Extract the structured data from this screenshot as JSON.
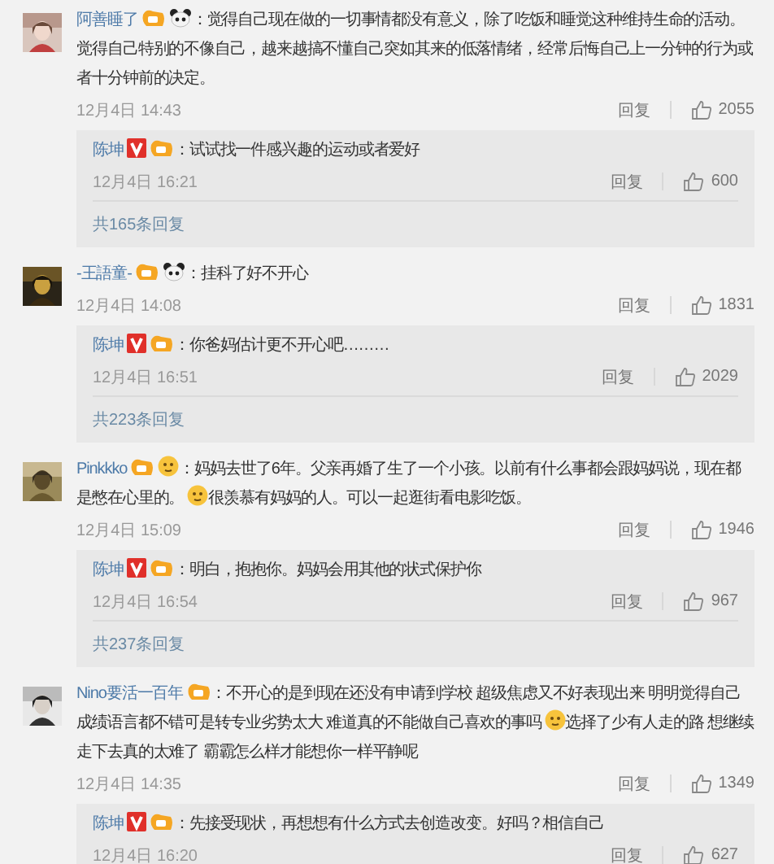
{
  "comments": [
    {
      "user": "阿善睡了",
      "badges": [
        {
          "kind": "level"
        },
        {
          "kind": "panda"
        }
      ],
      "segments": [
        {
          "kind": "text",
          "text": "：觉得自己现在做的一切事情都没有意义，除了吃饭和睡觉这种维持生命的活动。觉得自己特别的不像自己，越来越搞不懂自己突如其来的低落情绪，经常后悔自己上一分钟的行为或者十分钟前的决定。"
        }
      ],
      "time": "12月4日 14:43",
      "reply_label": "回复",
      "likes": "2055",
      "reply": {
        "user": "陈坤",
        "badges": [
          {
            "kind": "vip"
          },
          {
            "kind": "level"
          }
        ],
        "text": "：试试找一件感兴趣的运动或者爱好",
        "time": "12月4日 16:21",
        "reply_label": "回复",
        "likes": "600",
        "more": "共165条回复"
      }
    },
    {
      "user": "-王語童-",
      "badges": [
        {
          "kind": "level"
        },
        {
          "kind": "panda"
        }
      ],
      "segments": [
        {
          "kind": "text",
          "text": "：挂科了好不开心"
        }
      ],
      "time": "12月4日 14:08",
      "reply_label": "回复",
      "likes": "1831",
      "reply": {
        "user": "陈坤",
        "badges": [
          {
            "kind": "vip"
          },
          {
            "kind": "level"
          }
        ],
        "text": "：你爸妈估计更不开心吧………",
        "time": "12月4日 16:51",
        "reply_label": "回复",
        "likes": "2029",
        "more": "共223条回复"
      }
    },
    {
      "user": "Pinkkko",
      "badges": [
        {
          "kind": "level"
        },
        {
          "kind": "face"
        }
      ],
      "segments": [
        {
          "kind": "text",
          "text": "：妈妈去世了6年。父亲再婚了生了一个小孩。以前有什么事都会跟妈妈说，现在都是憋在心里的。"
        },
        {
          "kind": "emoji"
        },
        {
          "kind": "text",
          "text": "很羡慕有妈妈的人。可以一起逛街看电影吃饭。"
        }
      ],
      "time": "12月4日 15:09",
      "reply_label": "回复",
      "likes": "1946",
      "reply": {
        "user": "陈坤",
        "badges": [
          {
            "kind": "vip"
          },
          {
            "kind": "level"
          }
        ],
        "text": "：明白，抱抱你。妈妈会用其他的状式保护你",
        "time": "12月4日 16:54",
        "reply_label": "回复",
        "likes": "967",
        "more": "共237条回复"
      }
    },
    {
      "user": "Nino要活一百年",
      "badges": [
        {
          "kind": "level"
        }
      ],
      "segments": [
        {
          "kind": "text",
          "text": "：不开心的是到现在还没有申请到学校 超级焦虑又不好表现出来 明明觉得自己成绩语言都不错可是转专业劣势太大 难道真的不能做自己喜欢的事吗"
        },
        {
          "kind": "emoji"
        },
        {
          "kind": "text",
          "text": "选择了少有人走的路 想继续走下去真的太难了 霸霸怎么样才能想你一样平静呢"
        }
      ],
      "time": "12月4日 14:35",
      "reply_label": "回复",
      "likes": "1349",
      "reply": {
        "user": "陈坤",
        "badges": [
          {
            "kind": "vip"
          },
          {
            "kind": "level"
          }
        ],
        "text": "：先接受现状，再想想有什么方式去创造改变。好吗？相信自己",
        "time": "12月4日 16:20",
        "reply_label": "回复",
        "likes": "627"
      }
    }
  ]
}
